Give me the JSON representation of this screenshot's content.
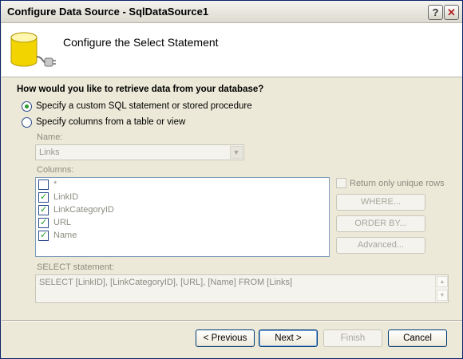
{
  "window": {
    "title": "Configure Data Source - SqlDataSource1",
    "help_glyph": "?",
    "close_glyph": "✕"
  },
  "header": {
    "title": "Configure the Select Statement",
    "icon": "database-plug-icon"
  },
  "question": "How would you like to retrieve data from your database?",
  "options": [
    {
      "label": "Specify a custom SQL statement or stored procedure",
      "checked": true
    },
    {
      "label": "Specify columns from a table or view",
      "checked": false
    }
  ],
  "name_field": {
    "label": "Name:",
    "value": "Links"
  },
  "columns": {
    "label": "Columns:",
    "items": [
      {
        "label": "*",
        "checked": false
      },
      {
        "label": "LinkID",
        "checked": true
      },
      {
        "label": "LinkCategoryID",
        "checked": true
      },
      {
        "label": "URL",
        "checked": true
      },
      {
        "label": "Name",
        "checked": true
      }
    ]
  },
  "unique_rows_label": "Return only unique rows",
  "side_buttons": {
    "where": "WHERE...",
    "order_by": "ORDER BY...",
    "advanced": "Advanced..."
  },
  "select_statement": {
    "label": "SELECT statement:",
    "value": "SELECT [LinkID], [LinkCategoryID], [URL], [Name] FROM [Links]"
  },
  "footer": {
    "previous": "< Previous",
    "next": "Next >",
    "finish": "Finish",
    "cancel": "Cancel"
  },
  "colors": {
    "accent_green": "#2a9d2a",
    "border_blue": "#003c74",
    "disabled_text": "#8c8c80"
  }
}
